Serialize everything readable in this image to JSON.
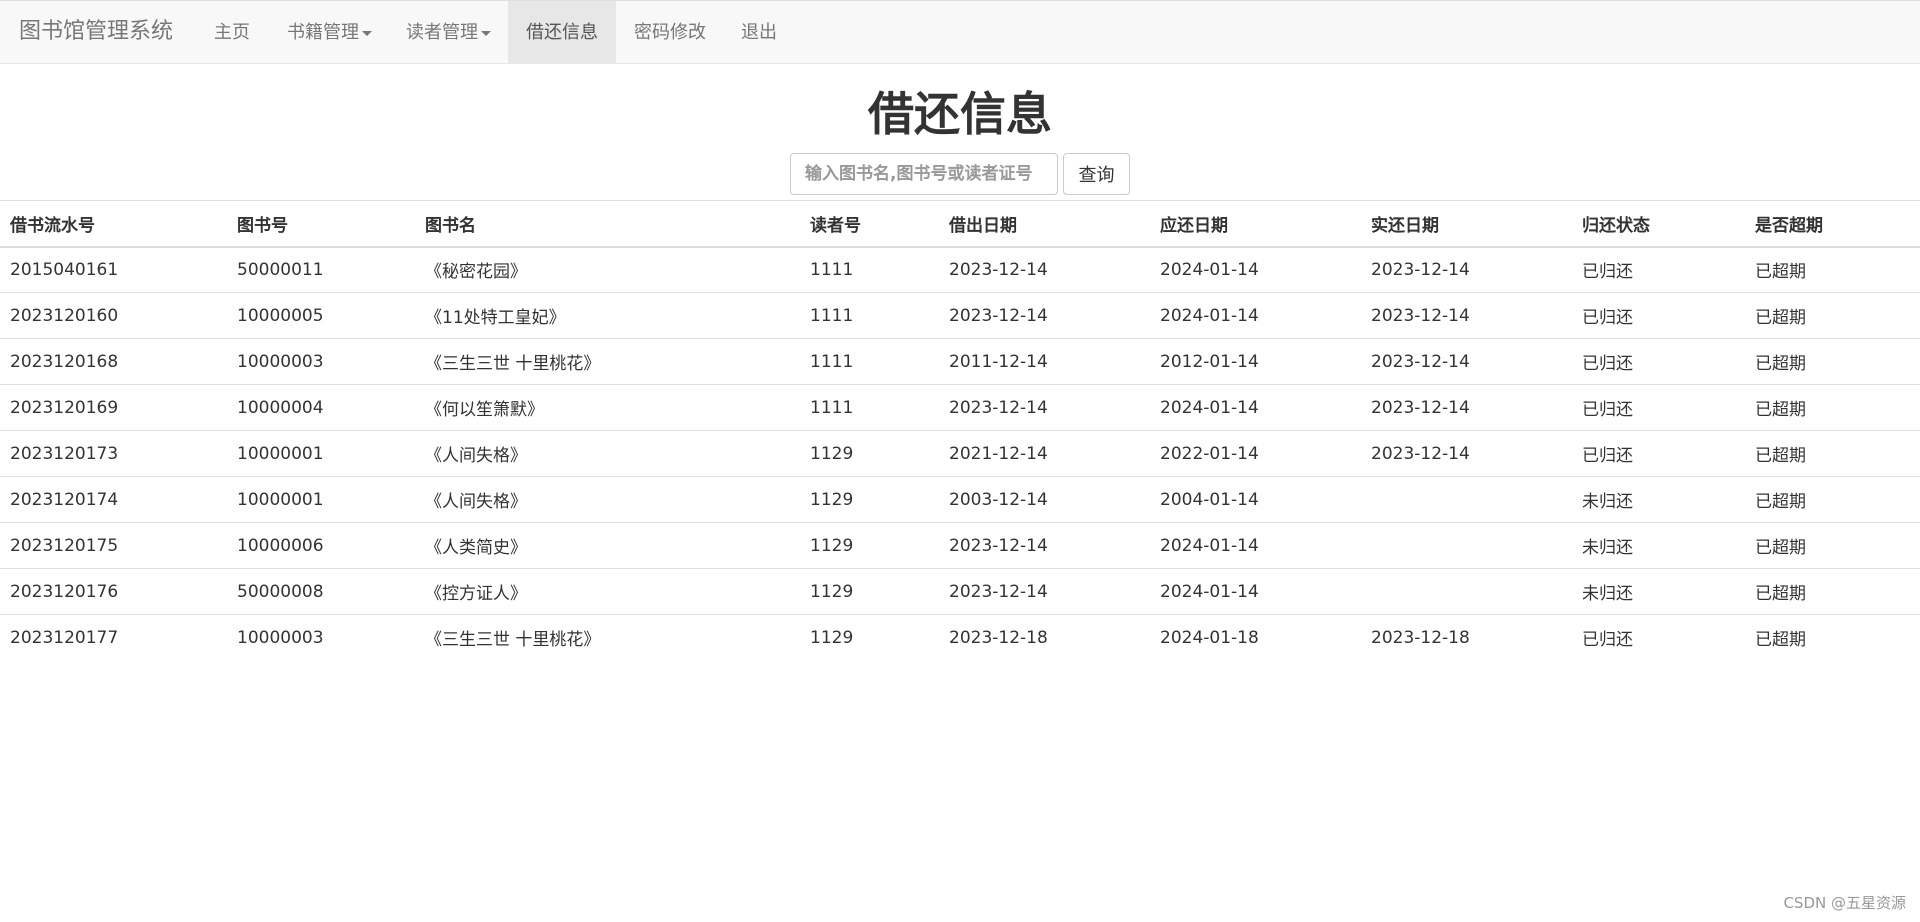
{
  "navbar": {
    "brand": "图书馆管理系统",
    "items": [
      {
        "label": "主页",
        "dropdown": false,
        "active": false
      },
      {
        "label": "书籍管理",
        "dropdown": true,
        "active": false
      },
      {
        "label": "读者管理",
        "dropdown": true,
        "active": false
      },
      {
        "label": "借还信息",
        "dropdown": false,
        "active": true
      },
      {
        "label": "密码修改",
        "dropdown": false,
        "active": false
      },
      {
        "label": "退出",
        "dropdown": false,
        "active": false
      }
    ]
  },
  "main": {
    "title": "借还信息",
    "search": {
      "placeholder": "输入图书名,图书号或读者证号",
      "value": "",
      "button_label": "查询"
    },
    "table": {
      "columns": [
        "借书流水号",
        "图书号",
        "图书名",
        "读者号",
        "借出日期",
        "应还日期",
        "实还日期",
        "归还状态",
        "是否超期"
      ],
      "rows": [
        [
          "2015040161",
          "50000011",
          "《秘密花园》",
          "1111",
          "2023-12-14",
          "2024-01-14",
          "2023-12-14",
          "已归还",
          "已超期"
        ],
        [
          "2023120160",
          "10000005",
          "《11处特工皇妃》",
          "1111",
          "2023-12-14",
          "2024-01-14",
          "2023-12-14",
          "已归还",
          "已超期"
        ],
        [
          "2023120168",
          "10000003",
          "《三生三世 十里桃花》",
          "1111",
          "2011-12-14",
          "2012-01-14",
          "2023-12-14",
          "已归还",
          "已超期"
        ],
        [
          "2023120169",
          "10000004",
          "《何以笙箫默》",
          "1111",
          "2023-12-14",
          "2024-01-14",
          "2023-12-14",
          "已归还",
          "已超期"
        ],
        [
          "2023120173",
          "10000001",
          "《人间失格》",
          "1129",
          "2021-12-14",
          "2022-01-14",
          "2023-12-14",
          "已归还",
          "已超期"
        ],
        [
          "2023120174",
          "10000001",
          "《人间失格》",
          "1129",
          "2003-12-14",
          "2004-01-14",
          "",
          "未归还",
          "已超期"
        ],
        [
          "2023120175",
          "10000006",
          "《人类简史》",
          "1129",
          "2023-12-14",
          "2024-01-14",
          "",
          "未归还",
          "已超期"
        ],
        [
          "2023120176",
          "50000008",
          "《控方证人》",
          "1129",
          "2023-12-14",
          "2024-01-14",
          "",
          "未归还",
          "已超期"
        ],
        [
          "2023120177",
          "10000003",
          "《三生三世 十里桃花》",
          "1129",
          "2023-12-18",
          "2024-01-18",
          "2023-12-18",
          "已归还",
          "已超期"
        ]
      ]
    }
  },
  "watermark": "CSDN @五星资源",
  "colors": {
    "navbar_bg": "#f8f8f8",
    "nav_active_bg": "#e7e7e7",
    "nav_text": "#777777",
    "text": "#333333",
    "border": "#dddddd"
  }
}
